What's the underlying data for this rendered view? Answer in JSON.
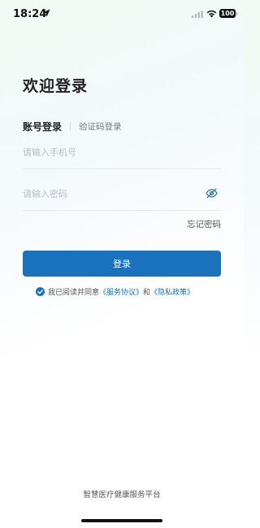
{
  "status_bar": {
    "time": "18:24",
    "battery": "100",
    "icons": [
      "location-arrow-icon",
      "cellular-signal-icon",
      "wifi-icon",
      "battery-icon"
    ]
  },
  "login": {
    "title": "欢迎登录",
    "tabs": {
      "account": "账号登录",
      "code": "验证码登录",
      "active": "account"
    },
    "phone_placeholder": "请输入手机号",
    "password_placeholder": "请输入密码",
    "forgot_password": "忘记密码",
    "submit_label": "登录",
    "agreement": {
      "prefix": "我已阅读并同意",
      "service_link": "《服务协议》",
      "conjunction": "和",
      "privacy_link": "《隐私政策》",
      "checked": true
    }
  },
  "footer": {
    "platform_name": "智慧医疗健康服务平台"
  },
  "colors": {
    "primary": "#1b72bc",
    "text": "#222222",
    "placeholder": "#b9bec3",
    "divider": "#e6e8ea"
  }
}
